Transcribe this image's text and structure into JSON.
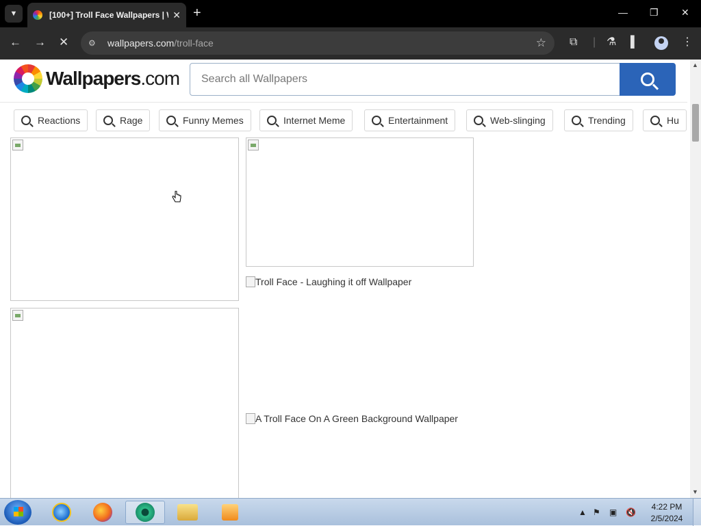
{
  "browser": {
    "tab_title": "[100+] Troll Face Wallpapers | W",
    "tab_close": "✕",
    "new_tab": "+",
    "url_domain": "wallpapers.com",
    "url_path": "/troll-face"
  },
  "site": {
    "logo_main": "Wallpapers",
    "logo_suffix": ".com",
    "search_placeholder": "Search all Wallpapers"
  },
  "chips": [
    "Reactions",
    "Rage",
    "Funny Memes",
    "Internet Meme",
    "Entertainment",
    "Web-slinging",
    "Trending",
    "Hu"
  ],
  "images": {
    "alt_1": "Troll Face - Laughing it off Wallpaper",
    "alt_2": "A Troll Face On A Green Background Wallpaper"
  },
  "taskbar": {
    "time": "4:22 PM",
    "date": "2/5/2024"
  }
}
